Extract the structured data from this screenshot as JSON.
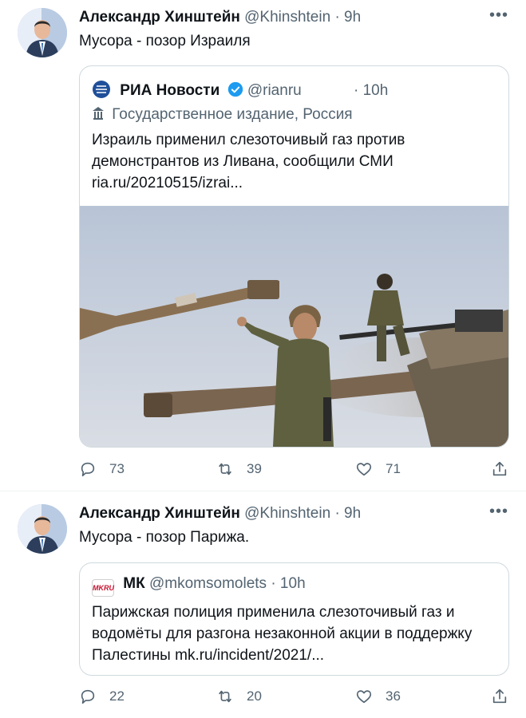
{
  "tweets": [
    {
      "author_name": "Александр Хинштейн",
      "author_handle": "@Khinshtein",
      "time": "· 9h",
      "more": "•••",
      "text": "Мусора - позор Израиля",
      "quote": {
        "name": "РИА Новости",
        "handle": "@rianru",
        "time": "· 10h",
        "label": "Государственное издание, Россия",
        "text": "Израиль применил слезоточивый газ против демонстрантов из Ливана, сообщили СМИ ria.ru/20210515/izrai..."
      },
      "replies": "73",
      "retweets": "39",
      "likes": "71"
    },
    {
      "author_name": "Александр Хинштейн",
      "author_handle": "@Khinshtein",
      "time": "· 9h",
      "more": "•••",
      "text": "Мусора - позор Парижа.",
      "quote": {
        "logo_text": "MKRU",
        "name": "МК",
        "handle": "@mkomsomolets",
        "time": "· 10h",
        "text": "Парижская полиция применила слезоточивый газ и водомёты для разгона незаконной акции в поддержку Палестины mk.ru/incident/2021/..."
      },
      "replies": "22",
      "retweets": "20",
      "likes": "36"
    }
  ],
  "icons": [
    "avatar",
    "verified-badge",
    "state-media-icon",
    "reply-icon",
    "retweet-icon",
    "like-icon",
    "share-icon"
  ],
  "colors": {
    "text": "#0f1419",
    "muted": "#536471",
    "verified": "#1d9bf0",
    "border": "#cfd9de"
  }
}
